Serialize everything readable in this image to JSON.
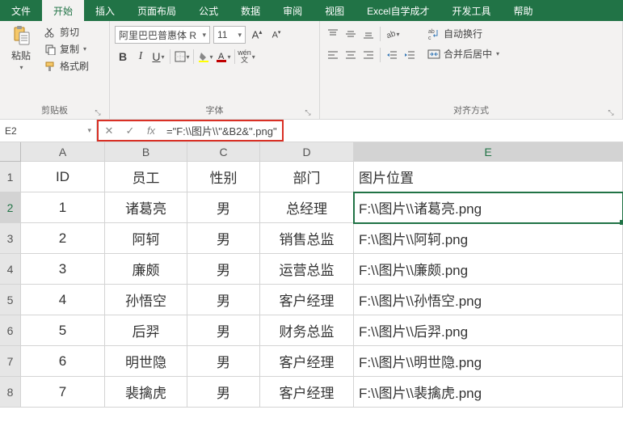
{
  "tabs": {
    "file": "文件",
    "home": "开始",
    "insert": "插入",
    "pageLayout": "页面布局",
    "formulas": "公式",
    "data": "数据",
    "review": "审阅",
    "view": "视图",
    "selfLearn": "Excel自学成才",
    "devTools": "开发工具",
    "help": "帮助"
  },
  "ribbon": {
    "clipboard": {
      "paste": "粘贴",
      "cut": "剪切",
      "copy": "复制",
      "formatPainter": "格式刷",
      "groupLabel": "剪贴板"
    },
    "font": {
      "name": "阿里巴巴普惠体 R",
      "size": "11",
      "groupLabel": "字体",
      "bold": "B",
      "italic": "I",
      "underline": "U",
      "pinyin": "wén"
    },
    "alignment": {
      "wrapText": "自动换行",
      "mergeCenter": "合并后居中",
      "groupLabel": "对齐方式",
      "wrapIcon": "ab"
    }
  },
  "formulaBar": {
    "nameBox": "E2",
    "formula": "=\"F:\\\\图片\\\\\"&B2&\".png\"",
    "fx": "fx"
  },
  "columns": [
    "A",
    "B",
    "C",
    "D",
    "E"
  ],
  "headers": {
    "A": "ID",
    "B": "员工",
    "C": "性别",
    "D": "部门",
    "E": "图片位置"
  },
  "rows": [
    {
      "n": "1",
      "A": "1",
      "B": "诸葛亮",
      "C": "男",
      "D": "总经理",
      "E": "F:\\\\图片\\\\诸葛亮.png"
    },
    {
      "n": "2",
      "A": "2",
      "B": "阿轲",
      "C": "男",
      "D": "销售总监",
      "E": "F:\\\\图片\\\\阿轲.png"
    },
    {
      "n": "3",
      "A": "3",
      "B": "廉颇",
      "C": "男",
      "D": "运营总监",
      "E": "F:\\\\图片\\\\廉颇.png"
    },
    {
      "n": "4",
      "A": "4",
      "B": "孙悟空",
      "C": "男",
      "D": "客户经理",
      "E": "F:\\\\图片\\\\孙悟空.png"
    },
    {
      "n": "5",
      "A": "5",
      "B": "后羿",
      "C": "男",
      "D": "财务总监",
      "E": "F:\\\\图片\\\\后羿.png"
    },
    {
      "n": "6",
      "A": "6",
      "B": "明世隐",
      "C": "男",
      "D": "客户经理",
      "E": "F:\\\\图片\\\\明世隐.png"
    },
    {
      "n": "7",
      "A": "7",
      "B": "裴擒虎",
      "C": "男",
      "D": "客户经理",
      "E": "F:\\\\图片\\\\裴擒虎.png"
    }
  ],
  "activeCell": "E2"
}
